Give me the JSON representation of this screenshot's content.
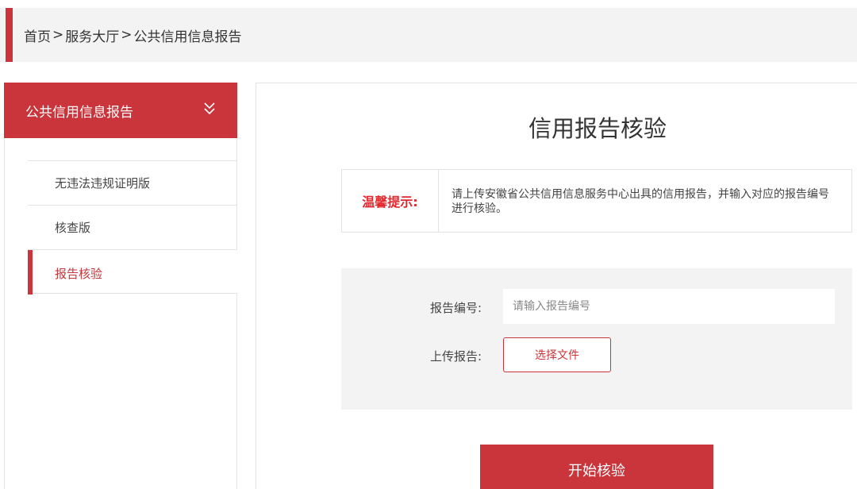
{
  "breadcrumb": {
    "items": [
      "首页",
      "服务大厅",
      "公共信用信息报告"
    ],
    "separator": ">"
  },
  "sidebar": {
    "header_title": "公共信用信息报告",
    "header_icon": "double-chevron-down-icon",
    "items": [
      {
        "label": "无违法违规证明版"
      },
      {
        "label": "核查版"
      },
      {
        "label": "报告核验"
      }
    ]
  },
  "main": {
    "title": "信用报告核验",
    "tip": {
      "label": "温馨提示:",
      "text": "请上传安徽省公共信用信息服务中心出具的信用报告，并输入对应的报告编号进行核验。"
    },
    "form": {
      "report_no_label": "报告编号:",
      "report_no_placeholder": "请输入报告编号",
      "report_no_value": "",
      "upload_label": "上传报告:",
      "file_button_label": "选择文件"
    },
    "start_button_label": "开始核验"
  },
  "colors": {
    "accent": "#c9353a",
    "tip_label": "#e0282e",
    "panel_bg": "#f3f3f3"
  }
}
